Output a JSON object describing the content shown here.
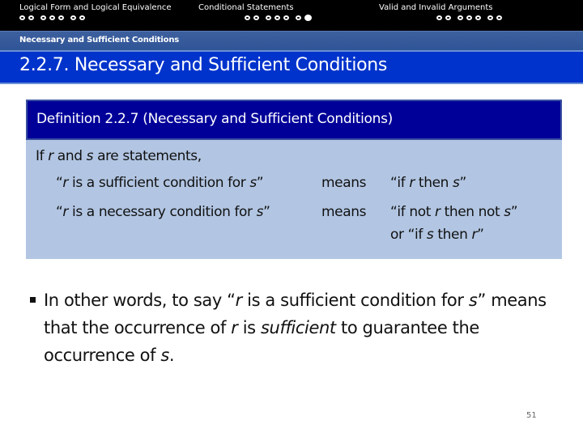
{
  "nav": {
    "sections": [
      {
        "title": "Logical Form and Logical Equivalence",
        "dots": 7,
        "current_dot": null
      },
      {
        "title": "Conditional Statements",
        "dots": 7,
        "current_dot": 7
      },
      {
        "title": "Valid and Invalid Arguments",
        "dots": 7,
        "current_dot": null
      }
    ]
  },
  "subsection": "Necessary and Sufficient Conditions",
  "slide_title": "2.2.7. Necessary and Sufficient Conditions",
  "definition": {
    "heading": "Definition 2.2.7 (Necessary and Sufficient Conditions)",
    "intro": {
      "pre": "If ",
      "r": "r",
      "mid": " and ",
      "s": "s",
      "post": " are statements,"
    },
    "rows": [
      {
        "left_open": "“",
        "left_r": "r",
        "left_text": " is a sufficient condition for ",
        "left_s": "s",
        "left_close": "”",
        "means": "means",
        "right": "“if r then s”"
      },
      {
        "left_open": "“",
        "left_r": "r",
        "left_text": " is a necessary condition for ",
        "left_s": "s",
        "left_close": "”",
        "means": "means",
        "right": "“if not r then not s”",
        "right2": "or “if s then r”"
      }
    ]
  },
  "bullet": {
    "p1": "In other words, to say “",
    "r1": "r",
    "p2": " is a sufficient condition for ",
    "s1": "s",
    "p3": "” means that the occurrence of ",
    "r2": "r",
    "p4": " is ",
    "emph": "sufficient",
    "p5": " to guarantee the occurrence of ",
    "s2": "s",
    "p6": "."
  },
  "page_number": "51",
  "colors": {
    "nav_bg": "#000000",
    "subbar_bg": "#2f5597",
    "title_bg": "#0033cc",
    "def_head_bg": "#000099",
    "def_body_bg": "#b2c6e3"
  }
}
